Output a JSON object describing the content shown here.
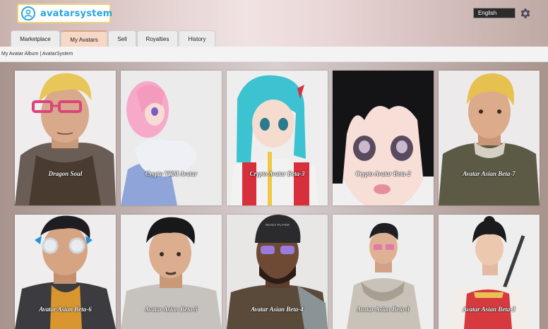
{
  "header": {
    "logo_text": "avatarsystem",
    "language": "English"
  },
  "tabs": [
    {
      "label": "Marketplace",
      "active": false
    },
    {
      "label": "My Avatars",
      "active": true
    },
    {
      "label": "Sell",
      "active": false
    },
    {
      "label": "Royalties",
      "active": false
    },
    {
      "label": "History",
      "active": false
    }
  ],
  "breadcrumb": "My Avatar Album | AvatarSystem",
  "avatars": [
    {
      "name": "Dragon Soul"
    },
    {
      "name": "Crypto VRM Avatar"
    },
    {
      "name": "Crypto Avatar Beta-3"
    },
    {
      "name": "Crypto Avatar Beta-2"
    },
    {
      "name": "Avatar Asian Beta-7"
    },
    {
      "name": "Avatar Asian Beta-6"
    },
    {
      "name": "Avatar Asian Beta-5"
    },
    {
      "name": "Avatar Asian Beta-4"
    },
    {
      "name": "Avatar Asian Beta-3"
    },
    {
      "name": "Avatar Asian Beta-2"
    }
  ],
  "cap_text": "READY PLAYER",
  "colors": {
    "brand": "#2aa7dc",
    "active_tab": "#f7d8c7"
  }
}
